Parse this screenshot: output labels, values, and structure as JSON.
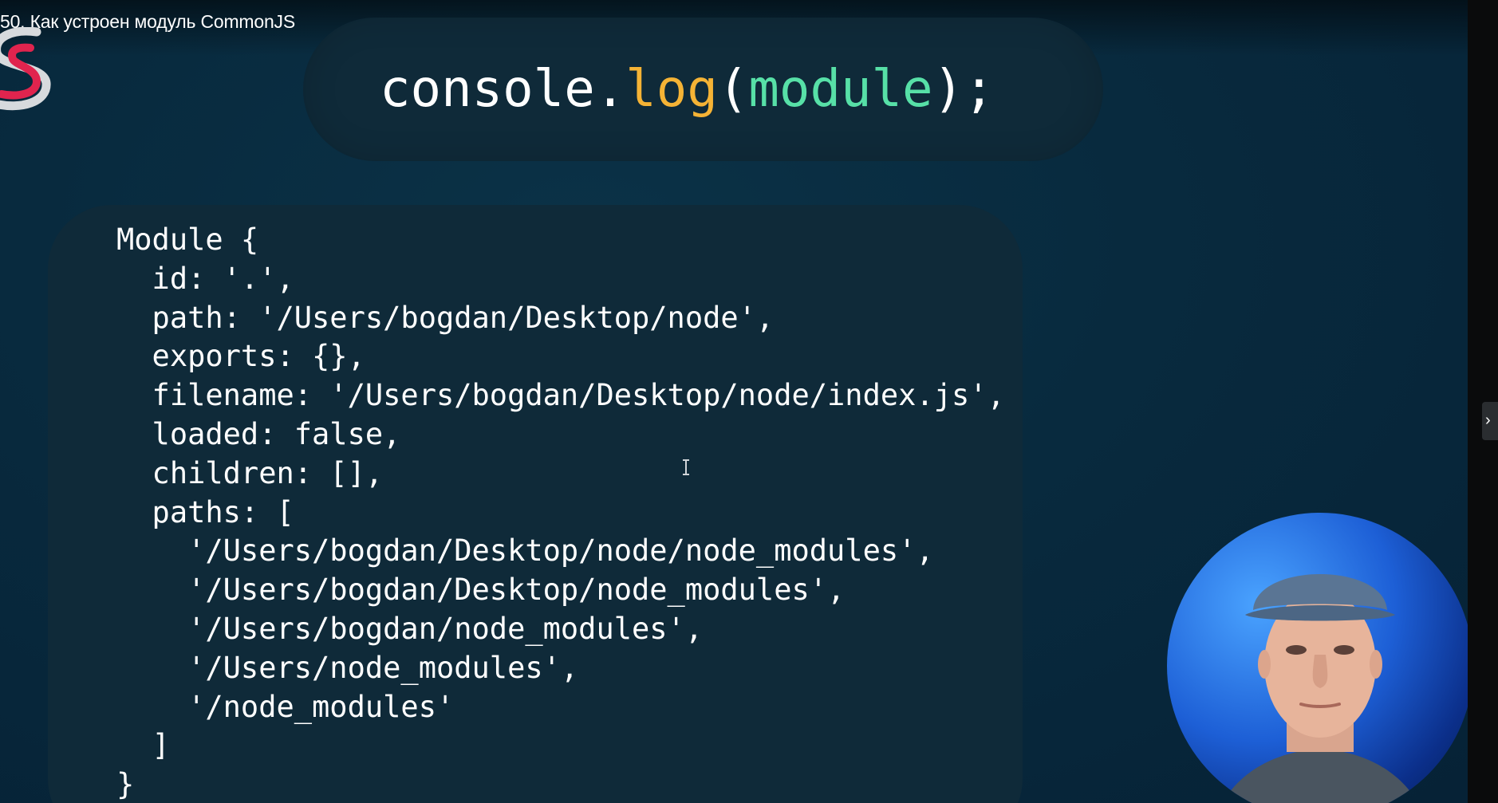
{
  "video": {
    "title": "50. Как устроен модуль CommonJS"
  },
  "code_snippet": {
    "tokens": [
      {
        "text": "console.",
        "role": "plain"
      },
      {
        "text": "log",
        "role": "fn"
      },
      {
        "text": "(",
        "role": "plain"
      },
      {
        "text": "module",
        "role": "arg"
      },
      {
        "text": ");",
        "role": "plain"
      }
    ]
  },
  "output": {
    "lines": [
      "Module {",
      "  id: '.',",
      "  path: '/Users/bogdan/Desktop/node',",
      "  exports: {},",
      "  filename: '/Users/bogdan/Desktop/node/index.js',",
      "  loaded: false,",
      "  children: [],",
      "  paths: [",
      "    '/Users/bogdan/Desktop/node/node_modules',",
      "    '/Users/bogdan/Desktop/node_modules',",
      "    '/Users/bogdan/node_modules',",
      "    '/Users/node_modules',",
      "    '/node_modules'",
      "  ]",
      "}"
    ]
  },
  "side_panel_toggle": {
    "icon": "chevron-right-icon",
    "glyph": "›"
  },
  "colors": {
    "background": "#082a3e",
    "card": "#0f2a39",
    "function": "#f5b335",
    "argument": "#57e0a7",
    "logo_red": "#e0244e",
    "text": "#ffffff"
  }
}
